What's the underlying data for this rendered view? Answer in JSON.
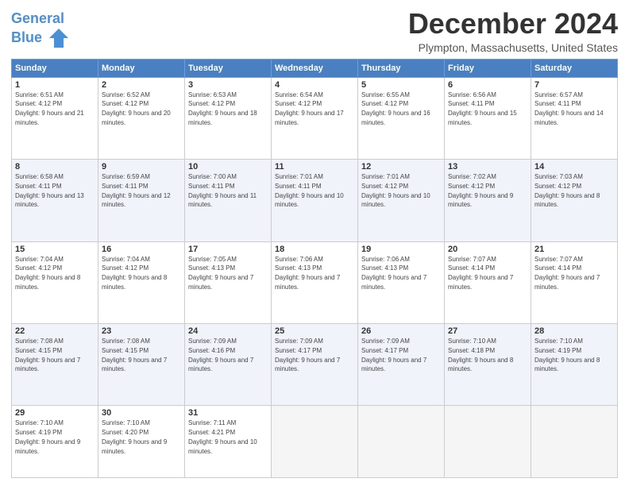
{
  "header": {
    "logo_line1": "General",
    "logo_line2": "Blue",
    "title": "December 2024",
    "subtitle": "Plympton, Massachusetts, United States"
  },
  "weekdays": [
    "Sunday",
    "Monday",
    "Tuesday",
    "Wednesday",
    "Thursday",
    "Friday",
    "Saturday"
  ],
  "weeks": [
    [
      {
        "day": "1",
        "sunrise": "6:51 AM",
        "sunset": "4:12 PM",
        "daylight": "9 hours and 21 minutes."
      },
      {
        "day": "2",
        "sunrise": "6:52 AM",
        "sunset": "4:12 PM",
        "daylight": "9 hours and 20 minutes."
      },
      {
        "day": "3",
        "sunrise": "6:53 AM",
        "sunset": "4:12 PM",
        "daylight": "9 hours and 18 minutes."
      },
      {
        "day": "4",
        "sunrise": "6:54 AM",
        "sunset": "4:12 PM",
        "daylight": "9 hours and 17 minutes."
      },
      {
        "day": "5",
        "sunrise": "6:55 AM",
        "sunset": "4:12 PM",
        "daylight": "9 hours and 16 minutes."
      },
      {
        "day": "6",
        "sunrise": "6:56 AM",
        "sunset": "4:11 PM",
        "daylight": "9 hours and 15 minutes."
      },
      {
        "day": "7",
        "sunrise": "6:57 AM",
        "sunset": "4:11 PM",
        "daylight": "9 hours and 14 minutes."
      }
    ],
    [
      {
        "day": "8",
        "sunrise": "6:58 AM",
        "sunset": "4:11 PM",
        "daylight": "9 hours and 13 minutes."
      },
      {
        "day": "9",
        "sunrise": "6:59 AM",
        "sunset": "4:11 PM",
        "daylight": "9 hours and 12 minutes."
      },
      {
        "day": "10",
        "sunrise": "7:00 AM",
        "sunset": "4:11 PM",
        "daylight": "9 hours and 11 minutes."
      },
      {
        "day": "11",
        "sunrise": "7:01 AM",
        "sunset": "4:11 PM",
        "daylight": "9 hours and 10 minutes."
      },
      {
        "day": "12",
        "sunrise": "7:01 AM",
        "sunset": "4:12 PM",
        "daylight": "9 hours and 10 minutes."
      },
      {
        "day": "13",
        "sunrise": "7:02 AM",
        "sunset": "4:12 PM",
        "daylight": "9 hours and 9 minutes."
      },
      {
        "day": "14",
        "sunrise": "7:03 AM",
        "sunset": "4:12 PM",
        "daylight": "9 hours and 8 minutes."
      }
    ],
    [
      {
        "day": "15",
        "sunrise": "7:04 AM",
        "sunset": "4:12 PM",
        "daylight": "9 hours and 8 minutes."
      },
      {
        "day": "16",
        "sunrise": "7:04 AM",
        "sunset": "4:12 PM",
        "daylight": "9 hours and 8 minutes."
      },
      {
        "day": "17",
        "sunrise": "7:05 AM",
        "sunset": "4:13 PM",
        "daylight": "9 hours and 7 minutes."
      },
      {
        "day": "18",
        "sunrise": "7:06 AM",
        "sunset": "4:13 PM",
        "daylight": "9 hours and 7 minutes."
      },
      {
        "day": "19",
        "sunrise": "7:06 AM",
        "sunset": "4:13 PM",
        "daylight": "9 hours and 7 minutes."
      },
      {
        "day": "20",
        "sunrise": "7:07 AM",
        "sunset": "4:14 PM",
        "daylight": "9 hours and 7 minutes."
      },
      {
        "day": "21",
        "sunrise": "7:07 AM",
        "sunset": "4:14 PM",
        "daylight": "9 hours and 7 minutes."
      }
    ],
    [
      {
        "day": "22",
        "sunrise": "7:08 AM",
        "sunset": "4:15 PM",
        "daylight": "9 hours and 7 minutes."
      },
      {
        "day": "23",
        "sunrise": "7:08 AM",
        "sunset": "4:15 PM",
        "daylight": "9 hours and 7 minutes."
      },
      {
        "day": "24",
        "sunrise": "7:09 AM",
        "sunset": "4:16 PM",
        "daylight": "9 hours and 7 minutes."
      },
      {
        "day": "25",
        "sunrise": "7:09 AM",
        "sunset": "4:17 PM",
        "daylight": "9 hours and 7 minutes."
      },
      {
        "day": "26",
        "sunrise": "7:09 AM",
        "sunset": "4:17 PM",
        "daylight": "9 hours and 7 minutes."
      },
      {
        "day": "27",
        "sunrise": "7:10 AM",
        "sunset": "4:18 PM",
        "daylight": "9 hours and 8 minutes."
      },
      {
        "day": "28",
        "sunrise": "7:10 AM",
        "sunset": "4:19 PM",
        "daylight": "9 hours and 8 minutes."
      }
    ],
    [
      {
        "day": "29",
        "sunrise": "7:10 AM",
        "sunset": "4:19 PM",
        "daylight": "9 hours and 9 minutes."
      },
      {
        "day": "30",
        "sunrise": "7:10 AM",
        "sunset": "4:20 PM",
        "daylight": "9 hours and 9 minutes."
      },
      {
        "day": "31",
        "sunrise": "7:11 AM",
        "sunset": "4:21 PM",
        "daylight": "9 hours and 10 minutes."
      },
      null,
      null,
      null,
      null
    ]
  ]
}
